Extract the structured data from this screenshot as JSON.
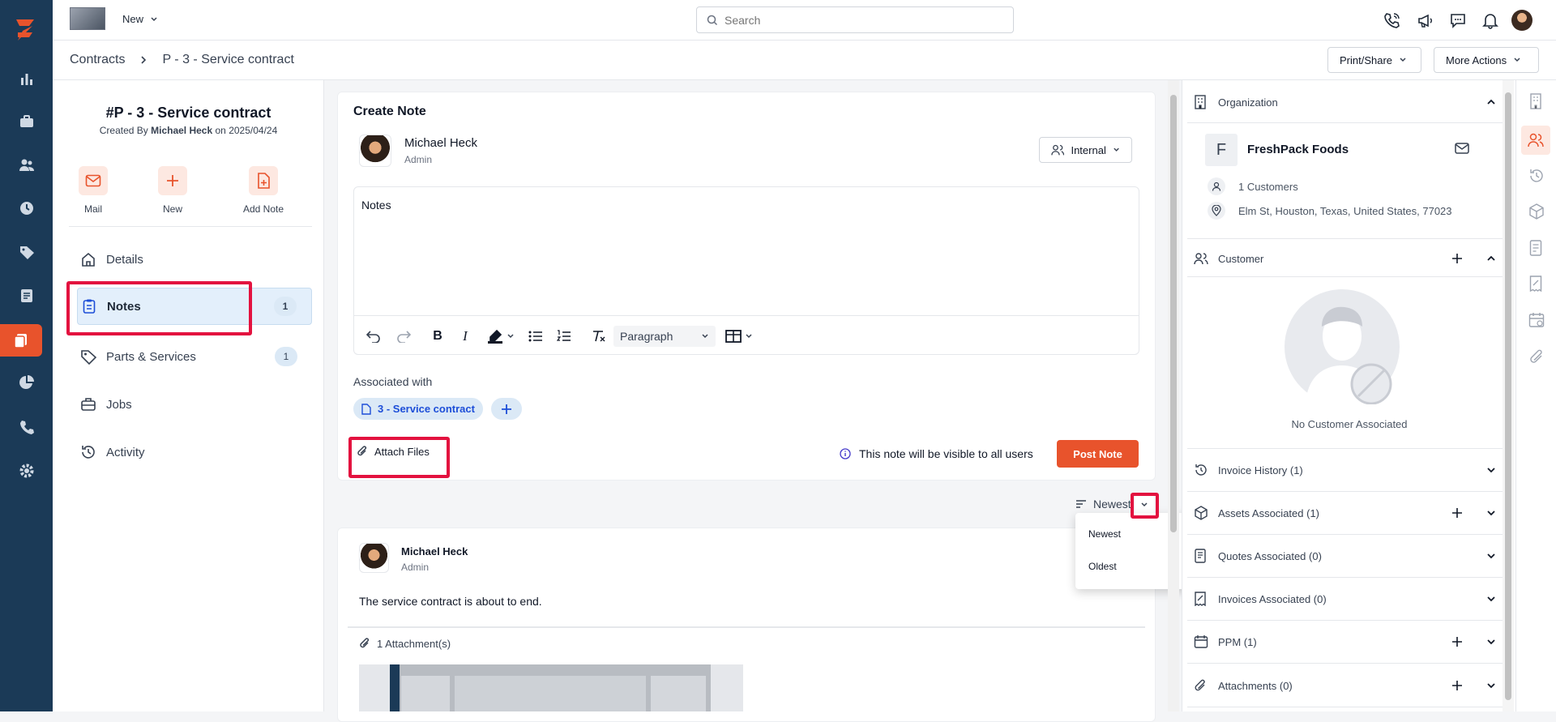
{
  "topbar": {
    "new_label": "New",
    "search_placeholder": "Search"
  },
  "breadcrumb": {
    "root": "Contracts",
    "current": "P - 3 - Service contract"
  },
  "actions": {
    "print_share": "Print/Share",
    "more_actions": "More Actions"
  },
  "record": {
    "title": "#P - 3 - Service contract",
    "created_prefix": "Created By",
    "created_by": "Michael Heck",
    "created_on_prefix": "on",
    "created_date": "2025/04/24"
  },
  "quick_actions": [
    {
      "label": "Mail",
      "icon": "mail-icon"
    },
    {
      "label": "New",
      "icon": "plus-icon"
    },
    {
      "label": "Add Note",
      "icon": "add-note-icon"
    }
  ],
  "nav": [
    {
      "label": "Details",
      "icon": "home-icon",
      "badge": null
    },
    {
      "label": "Notes",
      "icon": "clipboard-icon",
      "badge": "1"
    },
    {
      "label": "Parts & Services",
      "icon": "tag-icon",
      "badge": "1"
    },
    {
      "label": "Jobs",
      "icon": "briefcase-icon",
      "badge": null
    },
    {
      "label": "Activity",
      "icon": "history-icon",
      "badge": null
    }
  ],
  "create_note": {
    "title": "Create Note",
    "user_name": "Michael Heck",
    "user_role": "Admin",
    "visibility": "Internal",
    "editor_text": "Notes",
    "paragraph_style": "Paragraph",
    "associated_label": "Associated with",
    "associated_chip": "3 - Service contract",
    "attach_label": "Attach Files",
    "visibility_note": "This note will be visible to all users",
    "post_label": "Post Note"
  },
  "sort": {
    "current": "Newest",
    "options": [
      "Newest",
      "Oldest"
    ]
  },
  "note": {
    "author": "Michael Heck",
    "role": "Admin",
    "text": "The service contract is about to end.",
    "attachments_label": "1 Attachment(s)"
  },
  "organization": {
    "section_title": "Organization",
    "initial": "F",
    "name": "FreshPack Foods",
    "customers": "1 Customers",
    "address": "Elm St, Houston, Texas, United States, 77023"
  },
  "customer": {
    "section_title": "Customer",
    "empty_text": "No Customer Associated"
  },
  "sections": [
    {
      "label": "Invoice History (1)",
      "icon": "invoice-history-icon",
      "plus": false
    },
    {
      "label": "Assets Associated (1)",
      "icon": "box-icon",
      "plus": true
    },
    {
      "label": "Quotes Associated (0)",
      "icon": "quote-icon",
      "plus": false
    },
    {
      "label": "Invoices Associated (0)",
      "icon": "invoice-icon",
      "plus": false
    },
    {
      "label": "PPM (1)",
      "icon": "calendar-icon",
      "plus": true
    },
    {
      "label": "Attachments (0)",
      "icon": "paperclip-icon",
      "plus": true
    }
  ],
  "colors": {
    "brand": "#e8532c",
    "sidebar": "#1b3a57",
    "accent": "#2563eb",
    "highlight": "#e3123f"
  }
}
